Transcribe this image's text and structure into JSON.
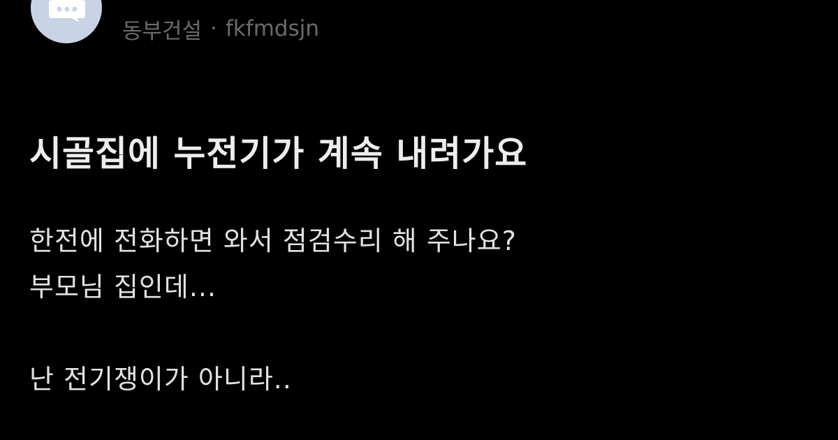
{
  "author": {
    "avatar_icon": "speech-bubble-icon",
    "avatar_color": "#c8d3e6",
    "name": "동부건설",
    "separator": "·",
    "username": "fkfmdsjn"
  },
  "post": {
    "title": "시골집에 누전기가 계속 내려가요",
    "body": {
      "line1": "한전에 전화하면 와서 점검수리 해 주나요?",
      "line2": "부모님 집인데...",
      "line3": "난 전기쟁이가 아니라.."
    }
  },
  "colors": {
    "background": "#000000",
    "meta_text": "#6b6b6b",
    "title_text": "#ededed",
    "body_text": "#e2e2e2"
  }
}
